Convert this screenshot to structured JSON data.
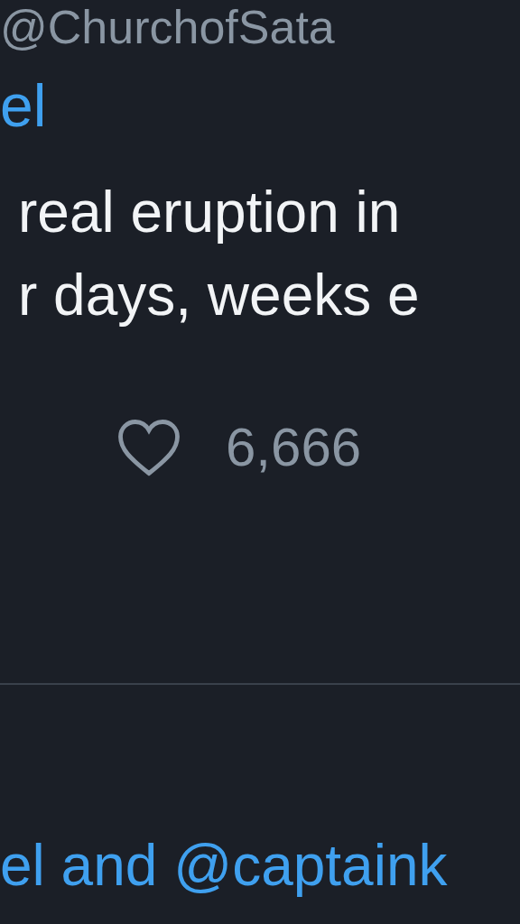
{
  "header": {
    "handle": "@ChurchofSata"
  },
  "tweet": {
    "mention_line": "el",
    "text_lines": [
      "real eruption in",
      "r days, weeks e"
    ],
    "like": {
      "count": "6,666",
      "liked": false
    }
  },
  "reply": {
    "text": "el and @captaink"
  }
}
